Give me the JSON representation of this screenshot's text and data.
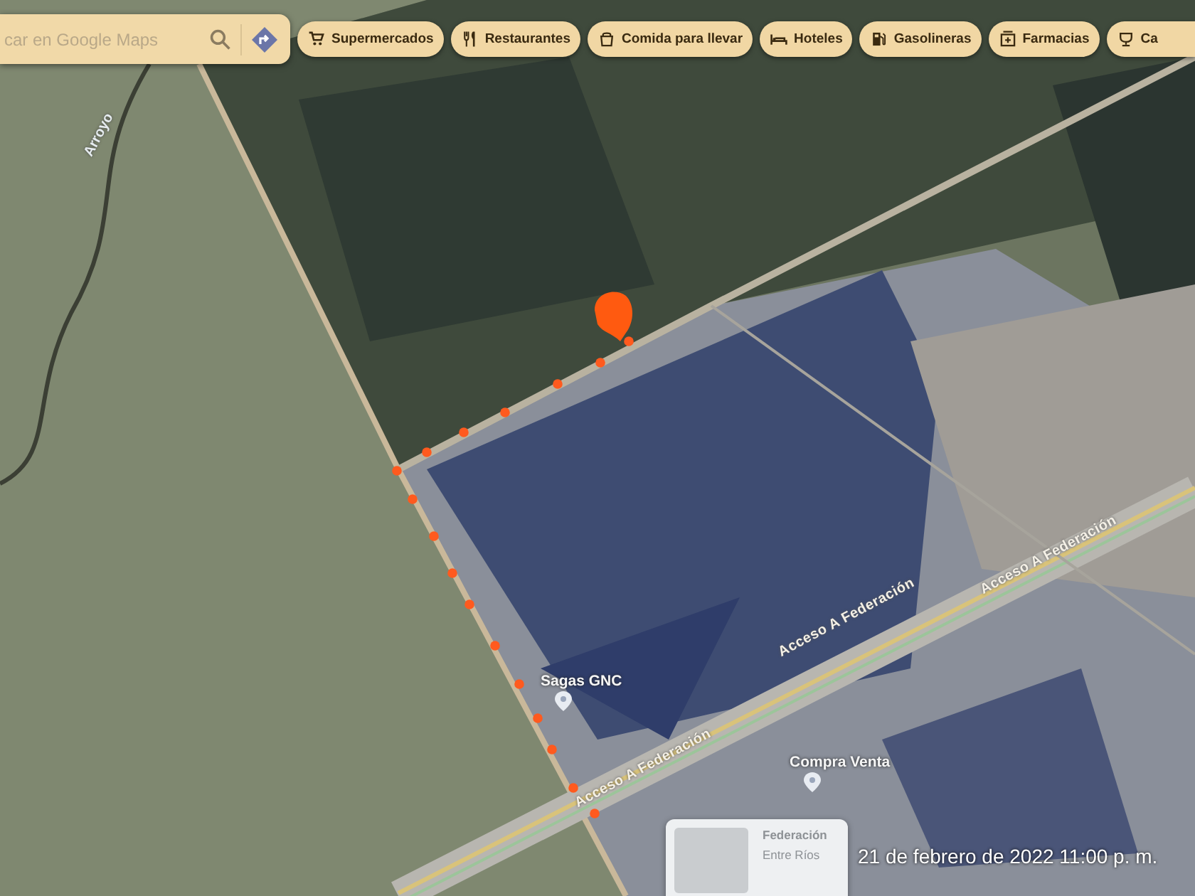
{
  "search": {
    "placeholder": "car en Google Maps"
  },
  "category_chips": [
    {
      "label": "Supermercados"
    },
    {
      "label": "Restaurantes"
    },
    {
      "label": "Comida para llevar"
    },
    {
      "label": "Hoteles"
    },
    {
      "label": "Gasolineras"
    },
    {
      "label": "Farmacias"
    },
    {
      "label": "Ca"
    }
  ],
  "map": {
    "labels": [
      {
        "text": "Arroyo",
        "kind": "water"
      },
      {
        "text": "Acceso A Federación",
        "kind": "road"
      },
      {
        "text": "Acceso A Federación",
        "kind": "road"
      },
      {
        "text": "Acceso A Federación",
        "kind": "road"
      },
      {
        "text": "Sagas GNC",
        "kind": "place"
      },
      {
        "text": "Compra Venta",
        "kind": "place"
      }
    ],
    "place_card": {
      "title": "Federación",
      "subtitle": "Entre Ríos"
    }
  },
  "photo_timestamp": "21 de febrero de 2022 11:00 p. m."
}
